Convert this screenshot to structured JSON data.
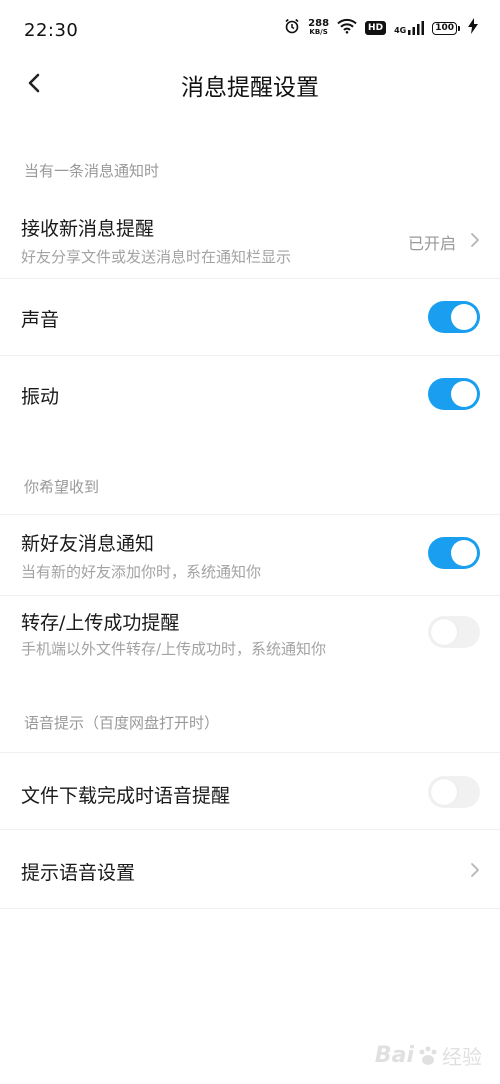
{
  "status_bar": {
    "time": "22:30",
    "speed_value": "288",
    "speed_unit": "KB/S",
    "hd_label": "HD",
    "network_label": "4G",
    "battery": "100",
    "icons": [
      "alarm-icon",
      "wifi-icon",
      "hd-icon",
      "signal-icon",
      "battery-icon",
      "charging-icon"
    ]
  },
  "header": {
    "title": "消息提醒设置",
    "back_icon": "chevron-left-icon"
  },
  "section1": {
    "label": "当有一条消息通知时",
    "receive": {
      "title": "接收新消息提醒",
      "subtitle": "好友分享文件或发送消息时在通知栏显示",
      "value": "已开启"
    },
    "sound": {
      "title": "声音",
      "enabled": true
    },
    "vibrate": {
      "title": "振动",
      "enabled": true
    }
  },
  "section2": {
    "label": "你希望收到",
    "new_friend": {
      "title": "新好友消息通知",
      "subtitle": "当有新的好友添加你时，系统通知你",
      "enabled": true
    },
    "transfer": {
      "title": "转存/上传成功提醒",
      "subtitle": "手机端以外文件转存/上传成功时，系统通知你",
      "enabled": false
    }
  },
  "section3": {
    "label": "语音提示（百度网盘打开时）",
    "download_voice": {
      "title": "文件下载完成时语音提醒",
      "enabled": false
    },
    "voice_settings": {
      "title": "提示语音设置"
    }
  },
  "watermark": {
    "text": "Bai",
    "text2": "经验"
  },
  "colors": {
    "toggle_on": "#1a9ff0",
    "toggle_off": "#f1f1f1",
    "secondary_text": "#999999"
  }
}
